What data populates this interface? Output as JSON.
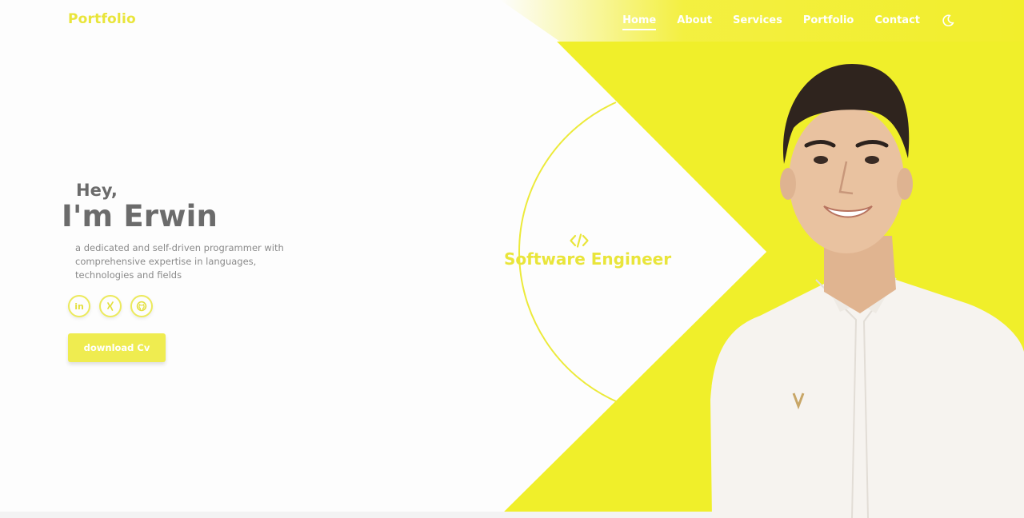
{
  "header": {
    "logo": "Portfolio",
    "nav": [
      {
        "label": "Home",
        "active": true
      },
      {
        "label": "About",
        "active": false
      },
      {
        "label": "Services",
        "active": false
      },
      {
        "label": "Portfolio",
        "active": false
      },
      {
        "label": "Contact",
        "active": false
      }
    ],
    "theme_icon": "moon-icon"
  },
  "hero": {
    "greeting": "Hey,",
    "name": "I'm Erwin",
    "bio": "a dedicated and self-driven programmer with comprehensive expertise in languages, technologies and fields",
    "socials": [
      {
        "icon": "linkedin-icon",
        "glyph": "in"
      },
      {
        "icon": "xing-icon",
        "glyph": "X"
      },
      {
        "icon": "github-icon",
        "glyph": ""
      }
    ],
    "cv_button": "download Cv"
  },
  "role": {
    "icon": "code-icon",
    "title": "Software Engineer"
  },
  "colors": {
    "accent": "#efec2a",
    "text": "#6b6b6b",
    "background": "#fdfdfd"
  }
}
